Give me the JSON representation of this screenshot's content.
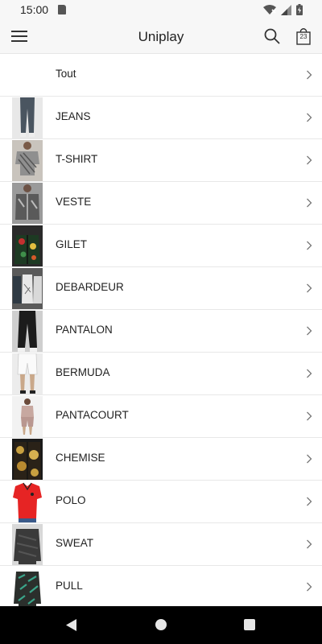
{
  "status_bar": {
    "time": "15:00"
  },
  "header": {
    "title": "Uniplay",
    "cart_count": "23"
  },
  "categories": [
    {
      "label": "Tout",
      "icon": "none"
    },
    {
      "label": "JEANS",
      "icon": "jeans-thumbnail"
    },
    {
      "label": "T-SHIRT",
      "icon": "tshirt-thumbnail"
    },
    {
      "label": "VESTE",
      "icon": "jacket-thumbnail"
    },
    {
      "label": "GILET",
      "icon": "cardigan-thumbnail"
    },
    {
      "label": "DEBARDEUR",
      "icon": "tank-top-thumbnail"
    },
    {
      "label": "PANTALON",
      "icon": "pants-thumbnail"
    },
    {
      "label": "BERMUDA",
      "icon": "shorts-thumbnail"
    },
    {
      "label": "PANTACOURT",
      "icon": "capri-thumbnail"
    },
    {
      "label": "CHEMISE",
      "icon": "shirt-thumbnail"
    },
    {
      "label": "POLO",
      "icon": "polo-thumbnail"
    },
    {
      "label": "SWEAT",
      "icon": "sweatshirt-thumbnail"
    },
    {
      "label": "PULL",
      "icon": "sweater-thumbnail"
    }
  ],
  "colors": {
    "accent_polo": "#e62424",
    "background": "#ffffff",
    "bar": "#f7f7f7",
    "nav": "#000000"
  }
}
